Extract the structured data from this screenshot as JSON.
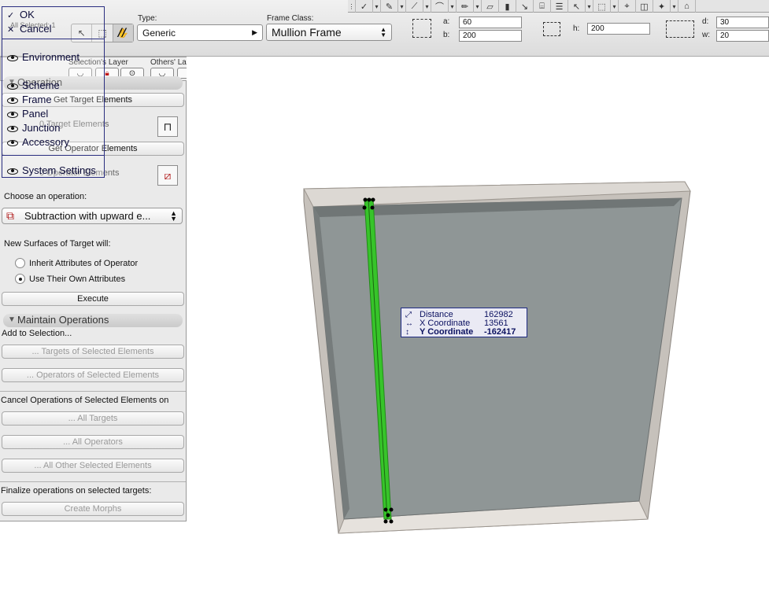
{
  "infobox": {
    "toolbar_icons": [
      "check-icon",
      "pen-icon",
      "slash-tool-icon",
      "curve-icon",
      "pencil-icon",
      "surface-icon",
      "wall-icon",
      "arrow-icon",
      "stair-icon",
      "list-icon",
      "pointer-icon",
      "marquee-icon",
      "camera-icon",
      "cube-icon",
      "bulb-icon",
      "house-icon"
    ],
    "all_selected": "All Selected: 1",
    "rotate_label": "//",
    "type_label": "Type:",
    "type_value": "Generic",
    "frame_class_label": "Frame Class:",
    "frame_class_value": "Mullion Frame",
    "a_label": "a:",
    "a_value": "60",
    "b_label": "b:",
    "b_value": "200",
    "h_label": "h:",
    "h_value": "200",
    "d_label": "d:",
    "d_value": "30",
    "w_label": "w:",
    "w_value": "20"
  },
  "layers": {
    "selection_label": "Selection's Layer",
    "others_label": "Others' Layer"
  },
  "context_menu": {
    "ok": "OK",
    "cancel": "Cancel",
    "items": [
      "Environment",
      "Scheme",
      "Frame",
      "Panel",
      "Junction",
      "Accessory"
    ],
    "system_settings": "System Settings"
  },
  "panel": {
    "operation_header": "Operation",
    "get_target": "Get Target Elements",
    "target_count": "0 Target Elements",
    "get_operator": "Get Operator Elements",
    "operator_count": "0 Operator Elements",
    "choose_label": "Choose an operation:",
    "operation_value": "Subtraction with upward e...",
    "new_surfaces_label": "New Surfaces of Target will:",
    "radio_inherit": "Inherit Attributes of Operator",
    "radio_own": "Use Their Own Attributes",
    "execute": "Execute",
    "maintain_header": "Maintain Operations",
    "add_label": "Add to Selection...",
    "targets_of_selected": "... Targets of Selected Elements",
    "operators_of_selected": "... Operators of Selected Elements",
    "cancel_label": "Cancel Operations of Selected Elements on",
    "all_targets": "... All Targets",
    "all_operators": "... All Operators",
    "all_other": "... All Other Selected Elements",
    "finalize_label": "Finalize operations on selected targets:",
    "create_morphs": "Create Morphs"
  },
  "tracker": {
    "distance_label": "Distance",
    "distance_value": "162982",
    "x_label": "X Coordinate",
    "x_value": "13561",
    "y_label": "Y Coordinate",
    "y_value": "-162417"
  }
}
